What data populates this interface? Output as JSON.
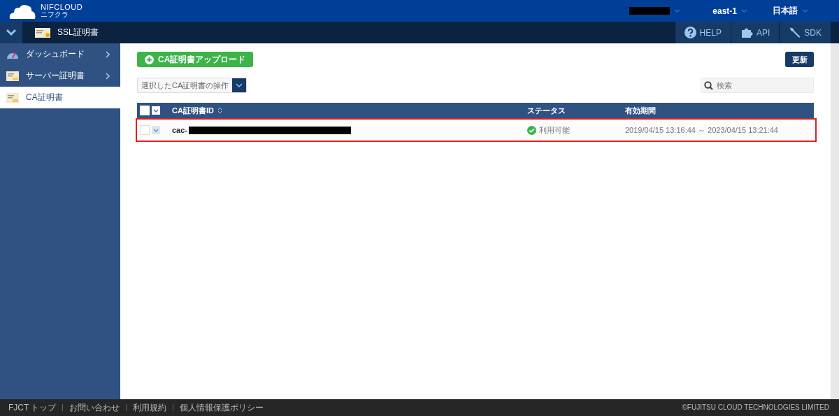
{
  "header": {
    "logo_text": "NIFCLOUD",
    "logo_subtext": "ニフクラ",
    "region": "east-1",
    "language": "日本語"
  },
  "subheader": {
    "title": "SSL証明書",
    "links": [
      {
        "kind": "help",
        "label": "HELP"
      },
      {
        "kind": "api",
        "label": "API"
      },
      {
        "kind": "sdk",
        "label": "SDK"
      }
    ]
  },
  "sidebar": {
    "items": [
      {
        "kind": "dashboard",
        "label": "ダッシュボード",
        "selected": false,
        "expandable": true
      },
      {
        "kind": "server",
        "label": "サーバー証明書",
        "selected": false,
        "expandable": true
      },
      {
        "kind": "ca",
        "label": "CA証明書",
        "selected": true,
        "expandable": false
      }
    ]
  },
  "toolbar": {
    "upload_button": "CA証明書アップロード",
    "refresh_button": "更新",
    "action_select": "選択したCA証明書の操作",
    "search": {
      "placeholder": "検索"
    }
  },
  "table": {
    "all_checked": false,
    "columns": [
      "CA証明書ID",
      "ステータス",
      "有効期間"
    ],
    "rows": [
      {
        "id": "cac-",
        "status": "利用可能",
        "period": "2019/04/15 13:16:44 ～ 2023/04/15 13:21:44",
        "checked": false,
        "outlined": true
      }
    ]
  },
  "footer": {
    "links": [
      "FJCT トップ",
      "お問い合わせ",
      "利用規約",
      "個人情報保護ポリシー"
    ],
    "copyright": "©FUJITSU CLOUD TECHNOLOGIES LIMITED"
  }
}
